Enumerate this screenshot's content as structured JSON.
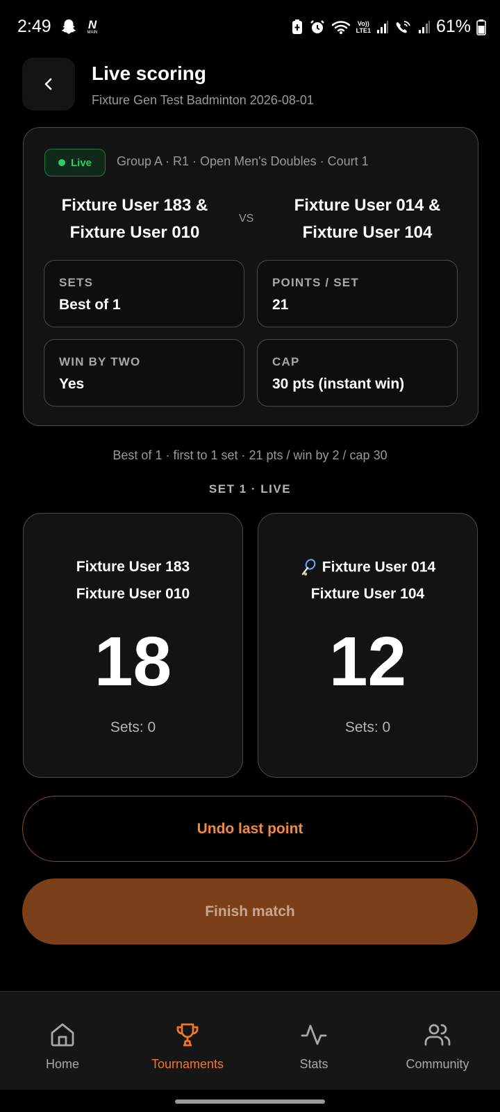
{
  "status_bar": {
    "time": "2:49",
    "battery_percent": "61%",
    "volte_label": "Vo))",
    "lte_label": "LTE1",
    "n_badge": "N",
    "n_badge_sub": "MAIN"
  },
  "header": {
    "title": "Live scoring",
    "subtitle": "Fixture Gen Test Badminton 2026-08-01"
  },
  "match": {
    "status": "Live",
    "meta": "Group A · R1 · Open Men's Doubles · Court 1",
    "team_a": [
      "Fixture User 183 &",
      "Fixture User 010"
    ],
    "team_b": [
      "Fixture User 014 &",
      "Fixture User 104"
    ],
    "vs": "VS",
    "info": [
      {
        "label": "SETS",
        "value": "Best of 1"
      },
      {
        "label": "POINTS / SET",
        "value": "21"
      },
      {
        "label": "WIN BY TWO",
        "value": "Yes"
      },
      {
        "label": "CAP",
        "value": "30 pts (instant win)"
      }
    ]
  },
  "rules_line": "Best of 1 · first to 1 set · 21 pts / win by 2 / cap 30",
  "set_label": "SET 1 · LIVE",
  "scores": [
    {
      "player1": "Fixture User 183",
      "player2": "Fixture User 010",
      "score": "18",
      "sets": "Sets: 0",
      "serving": false
    },
    {
      "player1": "Fixture User 014",
      "player2": "Fixture User 104",
      "score": "12",
      "sets": "Sets: 0",
      "serving": true
    }
  ],
  "buttons": {
    "undo": "Undo last point",
    "finish": "Finish match"
  },
  "nav": [
    {
      "label": "Home",
      "icon": "home-icon",
      "active": false
    },
    {
      "label": "Tournaments",
      "icon": "trophy-icon",
      "active": true
    },
    {
      "label": "Stats",
      "icon": "activity-icon",
      "active": false
    },
    {
      "label": "Community",
      "icon": "users-icon",
      "active": false
    }
  ],
  "colors": {
    "accent": "#f0762c",
    "live_green": "#2ecc6b",
    "finish_bg": "#7b3f1a"
  }
}
